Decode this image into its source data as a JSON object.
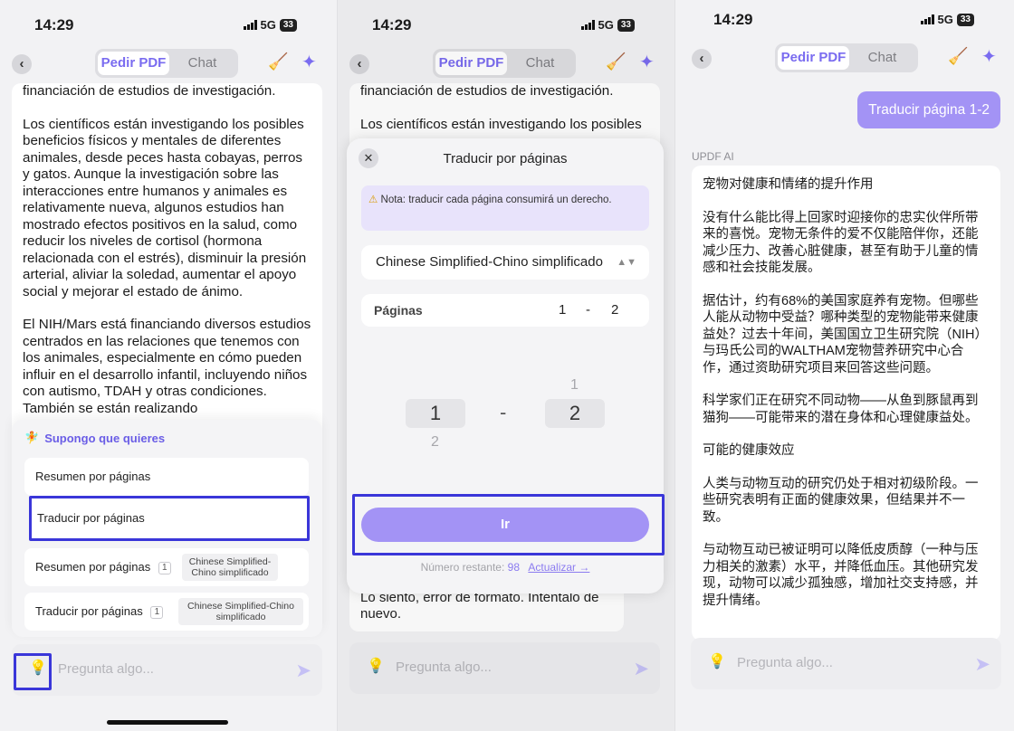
{
  "status": {
    "time": "14:29",
    "network": "5G",
    "battery": "33"
  },
  "nav": {
    "tab_pdf": "Pedir PDF",
    "tab_chat": "Chat"
  },
  "screen1": {
    "doc_paragraphs": [
      "financiación de estudios de investigación.",
      "Los científicos están investigando los posibles beneficios físicos y mentales de diferentes animales, desde peces hasta cobayas, perros y gatos. Aunque la investigación sobre las interacciones entre humanos y animales es relativamente nueva, algunos estudios han mostrado efectos positivos en la salud, como reducir los niveles de cortisol (hormona relacionada con el estrés), disminuir la presión arterial, aliviar la soledad, aumentar el apoyo social y mejorar el estado de ánimo.",
      "El NIH/Mars está financiando diversos estudios centrados en las relaciones que tenemos con los animales, especialmente en cómo pueden influir en el desarrollo infantil, incluyendo niños con autismo, TDAH y otras condiciones. También se están realizando"
    ],
    "suggest_title": "Supongo que quieres",
    "options": [
      "Resumen por páginas",
      "Traducir por páginas"
    ],
    "recent": [
      {
        "label": "Resumen por páginas",
        "count": "1",
        "lang": "Chinese Simplified-Chino simplificado"
      },
      {
        "label": "Traducir por páginas",
        "count": "1",
        "lang": "Chinese Simplified-Chino simplificado"
      }
    ],
    "input_placeholder": "Pregunta algo..."
  },
  "screen2": {
    "doc_paragraphs": [
      "financiación de estudios de investigación.",
      "Los científicos están investigando los posibles"
    ],
    "modal_title": "Traducir por páginas",
    "note": "Nota: traducir cada página consumirá un derecho.",
    "language": "Chinese Simplified-Chino simplificado",
    "pages_label": "Páginas",
    "pages_from": "1",
    "pages_sep": "-",
    "pages_to": "2",
    "picker_from": "1",
    "picker_from_next": "2",
    "picker_to": "2",
    "picker_to_prev": "1",
    "go_label": "Ir",
    "remaining_label": "Número restante:",
    "remaining_value": "98",
    "upgrade_label": "Actualizar →",
    "error_msg": "Lo siento, error de formato. Inténtalo de nuevo.",
    "input_placeholder": "Pregunta algo..."
  },
  "screen3": {
    "user_msg": "Traducir página 1-2",
    "ai_label": "UPDF AI",
    "ai_paragraphs": [
      "宠物对健康和情绪的提升作用",
      "没有什么能比得上回家时迎接你的忠实伙伴所带来的喜悦。宠物无条件的爱不仅能陪伴你，还能减少压力、改善心脏健康，甚至有助于儿童的情感和社会技能发展。",
      "据估计，约有68%的美国家庭养有宠物。但哪些人能从动物中受益？哪种类型的宠物能带来健康益处？过去十年间，美国国立卫生研究院（NIH）与玛氏公司的WALTHAM宠物营养研究中心合作，通过资助研究项目来回答这些问题。",
      "科学家们正在研究不同动物——从鱼到豚鼠再到猫狗——可能带来的潜在身体和心理健康益处。",
      "可能的健康效应",
      "人类与动物互动的研究仍处于相对初级阶段。一些研究表明有正面的健康效果，但结果并不一致。",
      "与动物互动已被证明可以降低皮质醇（一种与压力相关的激素）水平，并降低血压。其他研究发现，动物可以减少孤独感，增加社交支持感，并提升情绪。"
    ],
    "input_placeholder": "Pregunta algo..."
  },
  "colors": {
    "accent": "#7a6cf0",
    "button": "#a393f5",
    "highlight": "#3a36d9"
  }
}
